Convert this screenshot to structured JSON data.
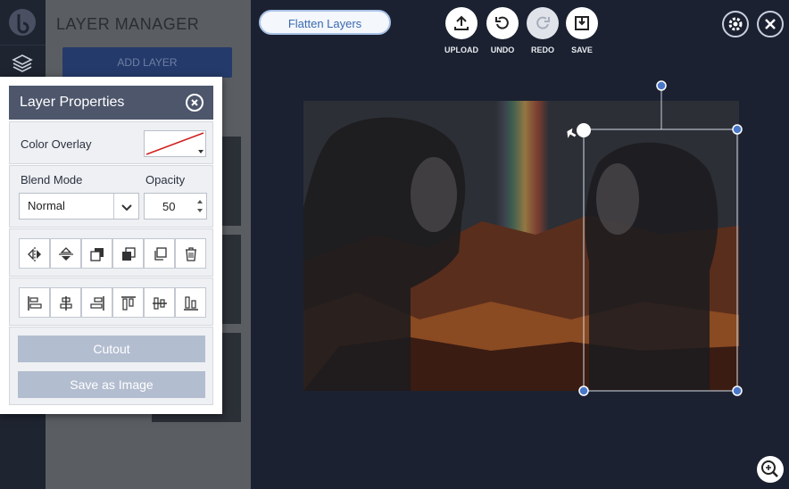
{
  "layer_manager": {
    "title": "LAYER MANAGER",
    "add_label": "ADD LAYER"
  },
  "toolbar": {
    "flatten_label": "Flatten Layers",
    "upload_label": "UPLOAD",
    "undo_label": "UNDO",
    "redo_label": "REDO",
    "save_label": "SAVE"
  },
  "layer_properties": {
    "title": "Layer Properties",
    "color_overlay_label": "Color Overlay",
    "blend_mode_label": "Blend Mode",
    "blend_mode_value": "Normal",
    "opacity_label": "Opacity",
    "opacity_value": "50",
    "cutout_label": "Cutout",
    "save_image_label": "Save as Image"
  },
  "icons": {
    "transform": [
      "flip-horizontal-icon",
      "flip-vertical-icon",
      "bring-forward-icon",
      "send-backward-icon",
      "duplicate-icon",
      "delete-icon"
    ],
    "align": [
      "align-left-icon",
      "align-center-horizontal-icon",
      "align-right-icon",
      "align-top-icon",
      "align-center-vertical-icon",
      "align-bottom-icon"
    ]
  },
  "colors": {
    "accent": "#3a6ab0",
    "panel_header": "#4d566b",
    "button_disabled": "#b3bdd0"
  }
}
